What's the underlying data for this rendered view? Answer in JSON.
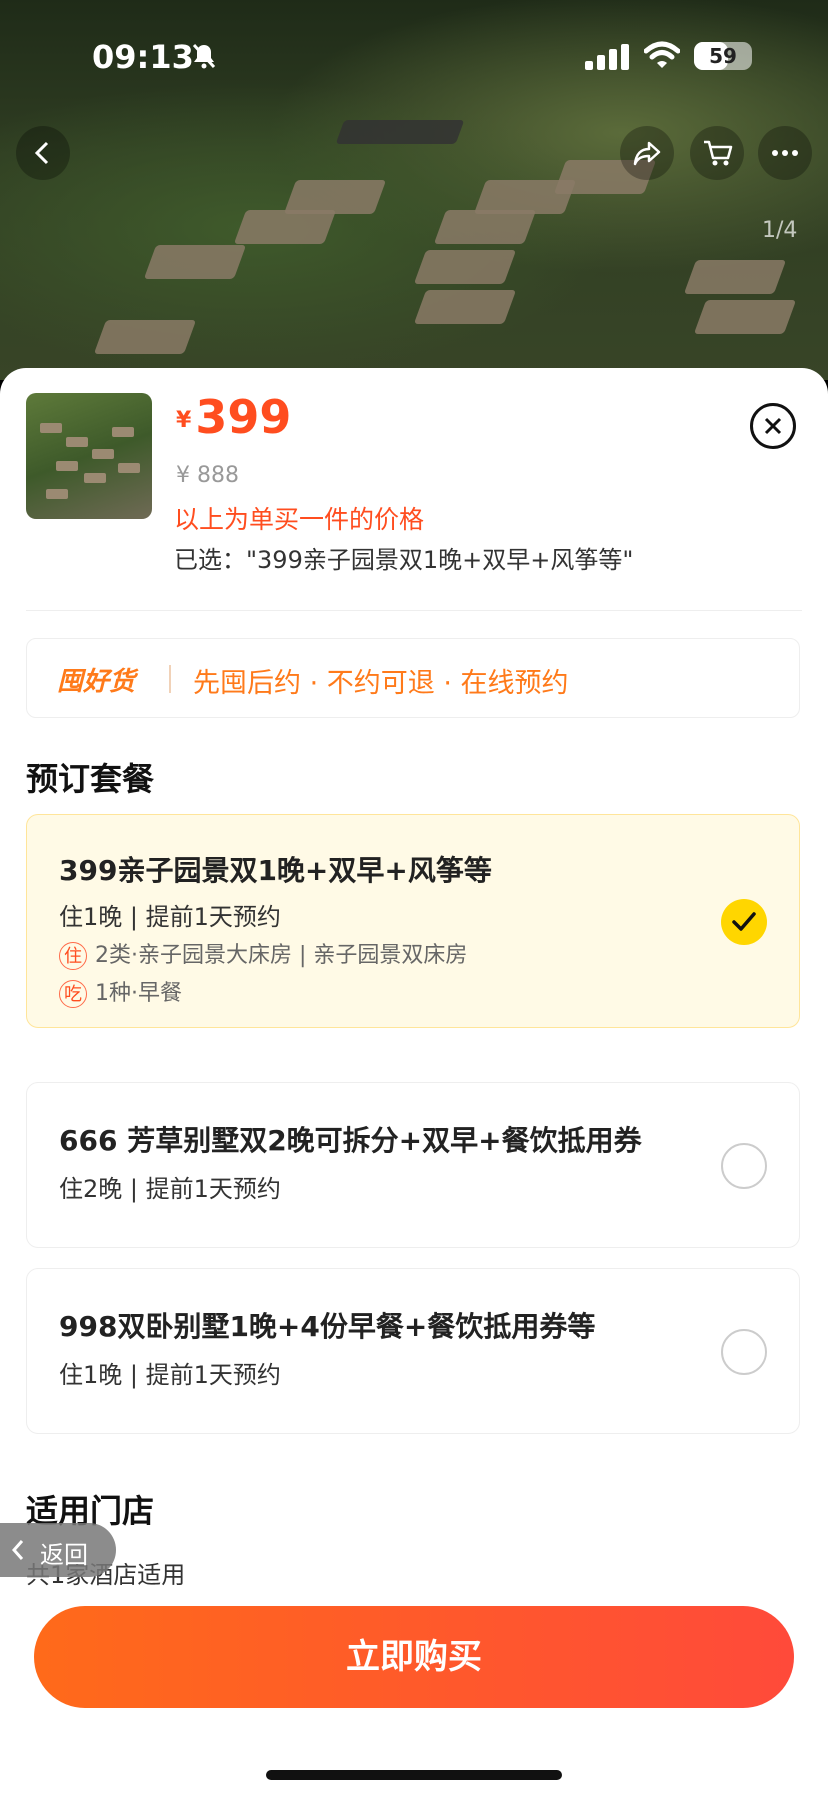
{
  "status_bar": {
    "time": "09:13",
    "battery": "59",
    "battery_level": 0.59
  },
  "gallery": {
    "counter": "1/4"
  },
  "product": {
    "currency": "¥",
    "price": "399",
    "original_price": "¥ 888",
    "price_note": "以上为单买一件的价格",
    "selected_text": "已选：\"399亲子园景双1晚+双早+风筝等\""
  },
  "promo": {
    "brand": "囤好货",
    "desc": "先囤后约 · 不约可退 · 在线预约"
  },
  "packages_section": {
    "title": "预订套餐",
    "items": [
      {
        "title": "399亲子园景双1晚+双早+风筝等",
        "sub": "住1晚 | 提前1天预约",
        "stay_tag": "住",
        "stay": "2类·亲子园景大床房 | 亲子园景双床房",
        "eat_tag": "吃",
        "eat": "1种·早餐",
        "selected": true
      },
      {
        "title": "666 芳草别墅双2晚可拆分+双早+餐饮抵用券",
        "sub": "住2晚 | 提前1天预约",
        "selected": false
      },
      {
        "title": "998双卧别墅1晚+4份早餐+餐饮抵用券等",
        "sub": "住1晚 | 提前1天预约",
        "selected": false
      }
    ]
  },
  "stores_section": {
    "title": "适用门店",
    "sub": "共1家酒店适用"
  },
  "back_button": {
    "label": "返回"
  },
  "buy_button": {
    "label": "立即购买"
  },
  "colors": {
    "accent": "#ff4d1f",
    "promo": "#ff7a1a",
    "check": "#ffd600"
  }
}
